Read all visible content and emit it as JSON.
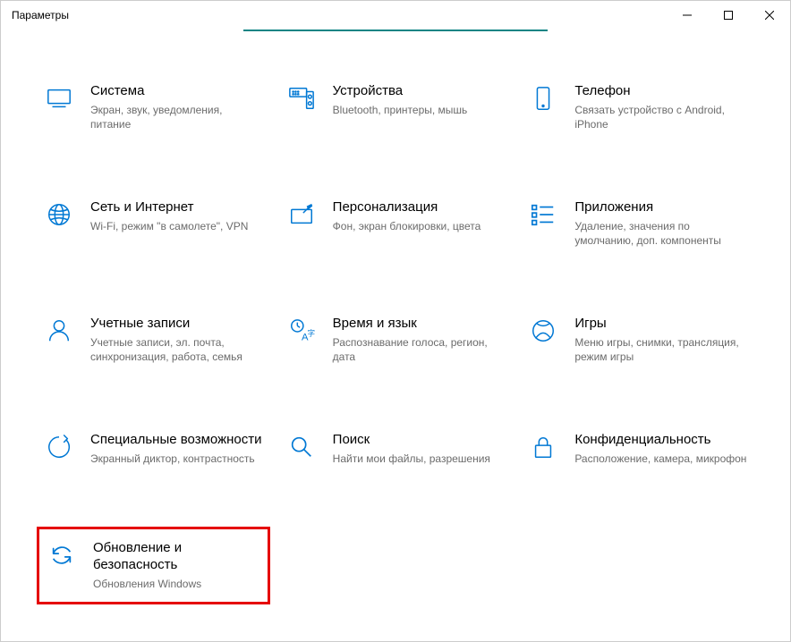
{
  "window": {
    "title": "Параметры"
  },
  "tiles": {
    "system": {
      "title": "Система",
      "desc": "Экран, звук, уведомления, питание"
    },
    "devices": {
      "title": "Устройства",
      "desc": "Bluetooth, принтеры, мышь"
    },
    "phone": {
      "title": "Телефон",
      "desc": "Связать устройство с Android, iPhone"
    },
    "network": {
      "title": "Сеть и Интернет",
      "desc": "Wi-Fi, режим \"в самолете\", VPN"
    },
    "personalize": {
      "title": "Персонализация",
      "desc": "Фон, экран блокировки, цвета"
    },
    "apps": {
      "title": "Приложения",
      "desc": "Удаление, значения по умолчанию, доп. компоненты"
    },
    "accounts": {
      "title": "Учетные записи",
      "desc": "Учетные записи, эл. почта, синхронизация, работа, семья"
    },
    "time": {
      "title": "Время и язык",
      "desc": "Распознавание голоса, регион, дата"
    },
    "gaming": {
      "title": "Игры",
      "desc": "Меню игры, снимки, трансляция, режим игры"
    },
    "ease": {
      "title": "Специальные возможности",
      "desc": "Экранный диктор, контрастность"
    },
    "search": {
      "title": "Поиск",
      "desc": "Найти мои файлы, разрешения"
    },
    "privacy": {
      "title": "Конфиденциальность",
      "desc": "Расположение, камера, микрофон"
    },
    "update": {
      "title": "Обновление и безопасность",
      "desc": "Обновления Windows"
    }
  }
}
